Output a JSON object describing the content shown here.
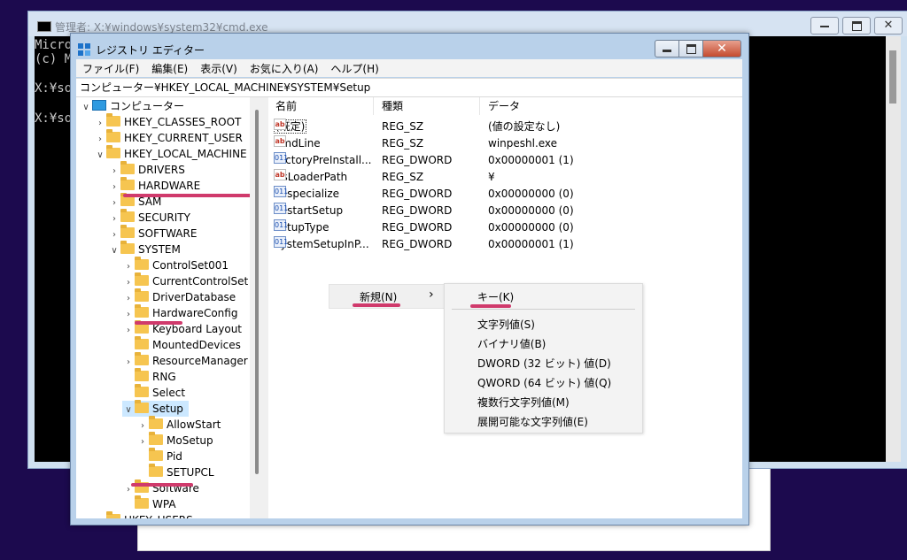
{
  "cmd": {
    "title": "管理者: X:¥windows¥system32¥cmd.exe",
    "lines": [
      "Micro",
      "(c) M",
      "X:¥so",
      "X:¥so"
    ]
  },
  "regedit": {
    "title": "レジストリ エディター",
    "menu": [
      "ファイル(F)",
      "編集(E)",
      "表示(V)",
      "お気に入り(A)",
      "ヘルプ(H)"
    ],
    "address": "コンピューター¥HKEY_LOCAL_MACHINE¥SYSTEM¥Setup",
    "tree": [
      {
        "label": "コンピューター",
        "chev": "∨"
      },
      {
        "label": "HKEY_CLASSES_ROOT",
        "chev": "›"
      },
      {
        "label": "HKEY_CURRENT_USER",
        "chev": "›"
      },
      {
        "label": "HKEY_LOCAL_MACHINE",
        "chev": "∨"
      },
      {
        "label": "DRIVERS",
        "chev": "›"
      },
      {
        "label": "HARDWARE",
        "chev": "›"
      },
      {
        "label": "SAM",
        "chev": "›"
      },
      {
        "label": "SECURITY",
        "chev": "›"
      },
      {
        "label": "SOFTWARE",
        "chev": "›"
      },
      {
        "label": "SYSTEM",
        "chev": "∨"
      },
      {
        "label": "ControlSet001",
        "chev": "›"
      },
      {
        "label": "CurrentControlSet",
        "chev": "›"
      },
      {
        "label": "DriverDatabase",
        "chev": "›"
      },
      {
        "label": "HardwareConfig",
        "chev": "›"
      },
      {
        "label": "Keyboard Layout",
        "chev": "›"
      },
      {
        "label": "MountedDevices",
        "chev": ""
      },
      {
        "label": "ResourceManager",
        "chev": "›"
      },
      {
        "label": "RNG",
        "chev": ""
      },
      {
        "label": "Select",
        "chev": ""
      },
      {
        "label": "Setup",
        "chev": "∨"
      },
      {
        "label": "AllowStart",
        "chev": "›"
      },
      {
        "label": "MoSetup",
        "chev": "›"
      },
      {
        "label": "Pid",
        "chev": ""
      },
      {
        "label": "SETUPCL",
        "chev": ""
      },
      {
        "label": "Software",
        "chev": "›"
      },
      {
        "label": "WPA",
        "chev": ""
      },
      {
        "label": "HKEY_USERS",
        "chev": ""
      }
    ],
    "columns": [
      "名前",
      "種類",
      "データ"
    ],
    "values": [
      {
        "icon": "string-value-icon",
        "name": "(既定)",
        "type": "REG_SZ",
        "data": "(値の設定なし)"
      },
      {
        "icon": "string-value-icon",
        "name": "CmdLine",
        "type": "REG_SZ",
        "data": "winpeshl.exe"
      },
      {
        "icon": "dword-value-icon",
        "name": "FactoryPreInstall...",
        "type": "REG_DWORD",
        "data": "0x00000001 (1)"
      },
      {
        "icon": "string-value-icon",
        "name": "OsLoaderPath",
        "type": "REG_SZ",
        "data": "¥"
      },
      {
        "icon": "dword-value-icon",
        "name": "Respecialize",
        "type": "REG_DWORD",
        "data": "0x00000000 (0)"
      },
      {
        "icon": "dword-value-icon",
        "name": "RestartSetup",
        "type": "REG_DWORD",
        "data": "0x00000000 (0)"
      },
      {
        "icon": "dword-value-icon",
        "name": "SetupType",
        "type": "REG_DWORD",
        "data": "0x00000000 (0)"
      },
      {
        "icon": "dword-value-icon",
        "name": "SystemSetupInP...",
        "type": "REG_DWORD",
        "data": "0x00000001 (1)"
      }
    ],
    "context_menu": {
      "new_label": "新規(N)",
      "arrow": "›"
    },
    "submenu": [
      "キー(K)",
      "文字列値(S)",
      "バイナリ値(B)",
      "DWORD (32 ビット) 値(D)",
      "QWORD (64 ビット) 値(Q)",
      "複数行文字列値(M)",
      "展開可能な文字列値(E)"
    ]
  },
  "colors": {
    "highlight_underline": "#d03a6c",
    "selection": "#cce8ff"
  }
}
